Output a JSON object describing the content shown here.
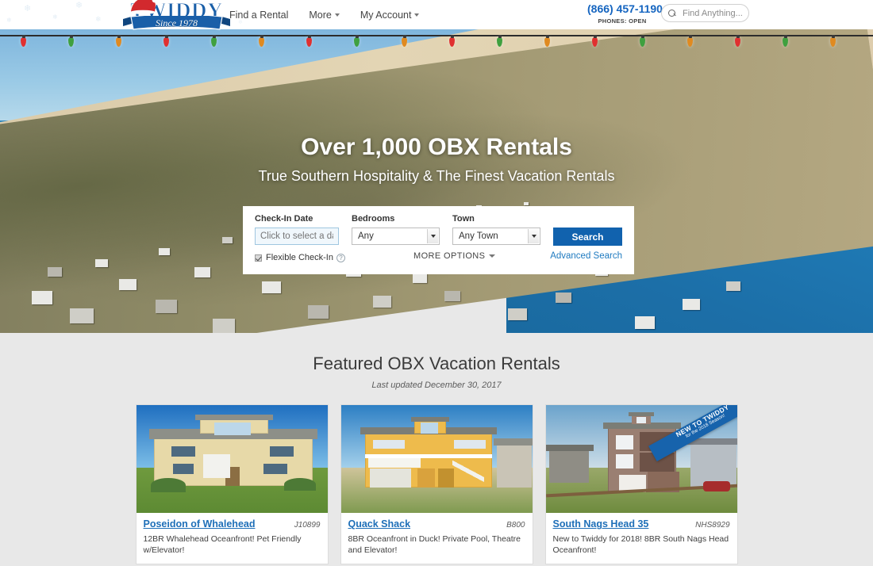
{
  "header": {
    "logo": {
      "brand": "TWIDDY",
      "tagline": "Since 1978",
      "hat_icon": "santa-hat-icon"
    },
    "nav": [
      {
        "label": "Find a Rental",
        "has_caret": false
      },
      {
        "label": "More",
        "has_caret": true
      },
      {
        "label": "My Account",
        "has_caret": true
      }
    ],
    "phone": {
      "number": "(866) 457-1190",
      "status": "PHONES: OPEN"
    },
    "search": {
      "placeholder": "Find Anything...",
      "value": "",
      "icon": "search-icon"
    }
  },
  "hero": {
    "headline": "Over 1,000 OBX Rentals",
    "subheadline": "True Southern Hospitality & The Finest Vacation Rentals",
    "decoration": "christmas-lights"
  },
  "search_panel": {
    "checkin": {
      "label": "Check-In Date",
      "placeholder": "Click to select a date",
      "value": ""
    },
    "bedrooms": {
      "label": "Bedrooms",
      "value": "Any"
    },
    "town": {
      "label": "Town",
      "value": "Any Town"
    },
    "search_button": "Search",
    "flexible_checkin": {
      "label": "Flexible Check-In",
      "checked": true,
      "help_icon": "question-mark-icon"
    },
    "more_options": "MORE OPTIONS",
    "advanced_search": "Advanced Search"
  },
  "featured": {
    "title": "Featured OBX Vacation Rentals",
    "subtitle": "Last updated December 30, 2017",
    "cards": [
      {
        "title": "Poseidon of Whalehead",
        "code": "J10899",
        "description": "12BR Whalehead Oceanfront! Pet Friendly w/Elevator!",
        "ribbon": null
      },
      {
        "title": "Quack Shack",
        "code": "B800",
        "description": "8BR Oceanfront in Duck! Private Pool, Theatre and Elevator!",
        "ribbon": null
      },
      {
        "title": "South Nags Head 35",
        "code": "NHS8929",
        "description": "New to Twiddy for 2018! 8BR South Nags Head Oceanfront!",
        "ribbon": {
          "line1": "NEW TO TWIDDY",
          "line2": "for the 2018 Season!"
        }
      }
    ]
  },
  "colors": {
    "brand_blue": "#1162ae",
    "link_blue": "#1e6fb8",
    "page_bg": "#e8e8e8",
    "ribbon_blue": "#1763ac"
  }
}
